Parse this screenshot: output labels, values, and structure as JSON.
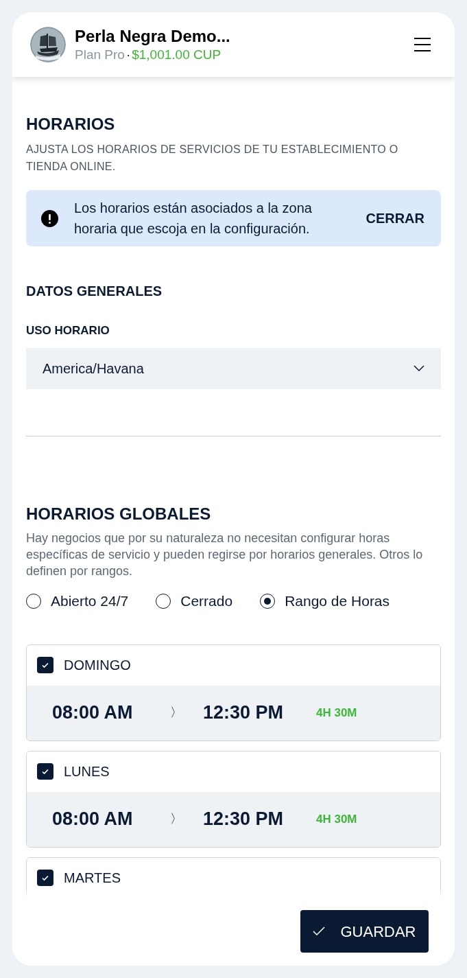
{
  "header": {
    "business_name": "Perla Negra Demo...",
    "plan": "Plan Pro",
    "separator": "·",
    "balance": "$1,001.00 CUP"
  },
  "page": {
    "title": "HORARIOS",
    "subtitle": "AJUSTA LOS HORARIOS DE SERVICIOS DE TU ESTABLECIMIENTO O TIENDA ONLINE."
  },
  "alert": {
    "message": "Los horarios están asociados a la zona horaria que escoja en la configuración.",
    "action": "CERRAR"
  },
  "general": {
    "title": "DATOS GENERALES",
    "timezone_label": "USO HORARIO",
    "timezone_value": "America/Havana"
  },
  "global": {
    "title": "HORARIOS GLOBALES",
    "description": "Hay negocios que por su naturaleza no necesitan configurar horas específicas de servicio y pueden regirse por horarios generales. Otros lo definen por rangos.",
    "options": [
      {
        "label": "Abierto 24/7",
        "selected": false
      },
      {
        "label": "Cerrado",
        "selected": false
      },
      {
        "label": "Rango de Horas",
        "selected": true
      }
    ]
  },
  "days": [
    {
      "name": "DOMINGO",
      "checked": true,
      "start": "08:00 AM",
      "separator": "〉",
      "end": "12:30 PM",
      "duration": "4H 30M"
    },
    {
      "name": "LUNES",
      "checked": true,
      "start": "08:00 AM",
      "separator": "〉",
      "end": "12:30 PM",
      "duration": "4H 30M"
    },
    {
      "name": "MARTES",
      "checked": true
    }
  ],
  "save_button": "GUARDAR"
}
